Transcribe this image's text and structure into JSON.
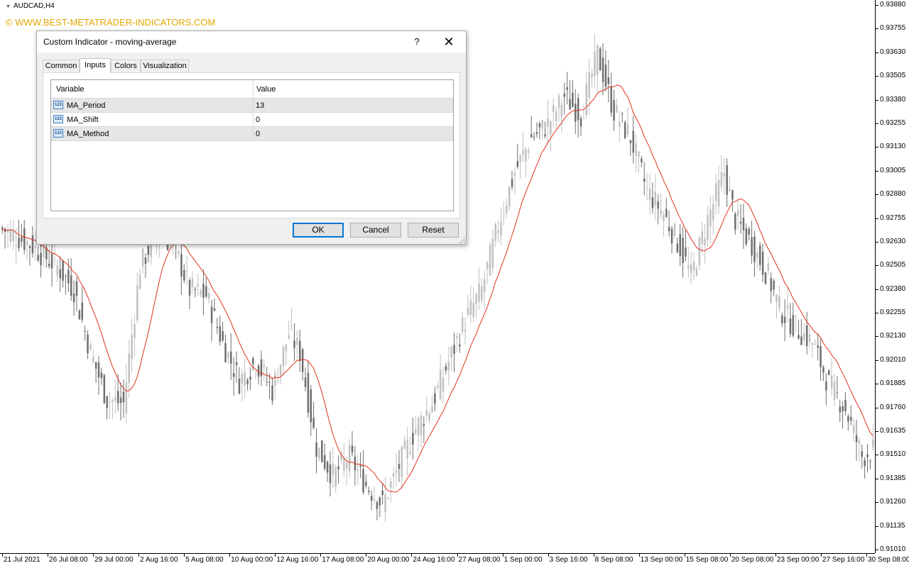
{
  "chart": {
    "symbol": "AUDCAD,H4",
    "watermark": "© WWW.BEST-METATRADER-INDICATORS.COM",
    "colors": {
      "bull": "#c0c0c0",
      "bear": "#6e6e6e",
      "ma": "#e0321e",
      "watermark": "#e0a800"
    }
  },
  "price_axis": [
    "0.93880",
    "0.93755",
    "0.93630",
    "0.93505",
    "0.93380",
    "0.93255",
    "0.93130",
    "0.93005",
    "0.92880",
    "0.92755",
    "0.92630",
    "0.92505",
    "0.92380",
    "0.92255",
    "0.92130",
    "0.92010",
    "0.91885",
    "0.91760",
    "0.91635",
    "0.91510",
    "0.91385",
    "0.91260",
    "0.91135",
    "0.91010"
  ],
  "time_axis": [
    "21 Jul 2021",
    "26 Jul 08:00",
    "29 Jul 00:00",
    "2 Aug 16:00",
    "5 Aug 08:00",
    "10 Aug 00:00",
    "12 Aug 16:00",
    "17 Aug 08:00",
    "20 Aug 00:00",
    "24 Aug 16:00",
    "27 Aug 08:00",
    "1 Sep 00:00",
    "3 Sep 16:00",
    "8 Sep 08:00",
    "13 Sep 00:00",
    "15 Sep 08:00",
    "20 Sep 08:00",
    "23 Sep 00:00",
    "27 Sep 16:00",
    "30 Sep 08:00"
  ],
  "dialog": {
    "title": "Custom Indicator - moving-average",
    "help_label": "?",
    "close_label": "✕",
    "tabs": [
      "Common",
      "Inputs",
      "Colors",
      "Visualization"
    ],
    "active_tab": "Inputs",
    "grid": {
      "headers": {
        "variable": "Variable",
        "value": "Value"
      },
      "icon_text": "123",
      "rows": [
        {
          "variable": "MA_Period",
          "value": "13"
        },
        {
          "variable": "MA_Shift",
          "value": "0"
        },
        {
          "variable": "MA_Method",
          "value": "0"
        }
      ]
    },
    "buttons": {
      "ok": "OK",
      "cancel": "Cancel",
      "reset": "Reset"
    }
  },
  "chart_data": {
    "type": "candlestick",
    "symbol": "AUDCAD",
    "timeframe": "H4",
    "ylim": [
      0.9101,
      0.9388
    ],
    "x_labels": [
      "21 Jul 2021",
      "26 Jul 08:00",
      "29 Jul 00:00",
      "2 Aug 16:00",
      "5 Aug 08:00",
      "10 Aug 00:00",
      "12 Aug 16:00",
      "17 Aug 08:00",
      "20 Aug 00:00",
      "24 Aug 16:00",
      "27 Aug 08:00",
      "1 Sep 00:00",
      "3 Sep 16:00",
      "8 Sep 08:00",
      "13 Sep 00:00",
      "15 Sep 08:00",
      "20 Sep 08:00",
      "23 Sep 00:00",
      "27 Sep 16:00",
      "30 Sep 08:00"
    ],
    "anchors": [
      [
        0,
        0.927
      ],
      [
        10,
        0.9262
      ],
      [
        20,
        0.925
      ],
      [
        26,
        0.9238
      ],
      [
        32,
        0.9205
      ],
      [
        38,
        0.918
      ],
      [
        44,
        0.9178
      ],
      [
        50,
        0.925
      ],
      [
        56,
        0.9268
      ],
      [
        62,
        0.9262
      ],
      [
        68,
        0.9238
      ],
      [
        74,
        0.9235
      ],
      [
        80,
        0.921
      ],
      [
        86,
        0.919
      ],
      [
        92,
        0.92
      ],
      [
        98,
        0.9185
      ],
      [
        104,
        0.9215
      ],
      [
        108,
        0.9205
      ],
      [
        114,
        0.9155
      ],
      [
        120,
        0.914
      ],
      [
        126,
        0.915
      ],
      [
        132,
        0.9135
      ],
      [
        138,
        0.9125
      ],
      [
        144,
        0.9145
      ],
      [
        150,
        0.9165
      ],
      [
        156,
        0.9178
      ],
      [
        162,
        0.92
      ],
      [
        168,
        0.9222
      ],
      [
        174,
        0.9238
      ],
      [
        180,
        0.9272
      ],
      [
        186,
        0.93
      ],
      [
        192,
        0.9318
      ],
      [
        198,
        0.9325
      ],
      [
        204,
        0.934
      ],
      [
        210,
        0.933
      ],
      [
        216,
        0.9362
      ],
      [
        222,
        0.9332
      ],
      [
        228,
        0.9318
      ],
      [
        234,
        0.929
      ],
      [
        240,
        0.9278
      ],
      [
        246,
        0.926
      ],
      [
        250,
        0.9245
      ],
      [
        256,
        0.9275
      ],
      [
        262,
        0.93
      ],
      [
        266,
        0.9275
      ],
      [
        272,
        0.9262
      ],
      [
        278,
        0.9245
      ],
      [
        282,
        0.9228
      ],
      [
        288,
        0.9218
      ],
      [
        294,
        0.921
      ],
      [
        300,
        0.9188
      ],
      [
        306,
        0.9175
      ],
      [
        312,
        0.915
      ],
      [
        318,
        0.9155
      ]
    ],
    "ma_period": 13,
    "ma_shift": 0,
    "ma_method": 0
  }
}
